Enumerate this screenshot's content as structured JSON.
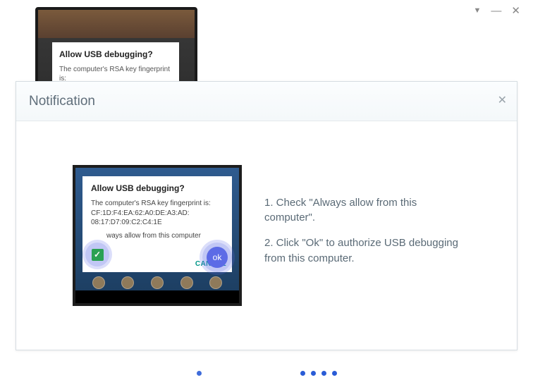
{
  "window": {
    "pin_glyph": "▼",
    "min_glyph": "—",
    "close_glyph": "✕"
  },
  "bg_phone": {
    "dialog_title": "Allow USB debugging?",
    "line1": "The computer's RSA key fingerprint",
    "line2": "is:"
  },
  "modal": {
    "title": "Notification",
    "close_glyph": "✕",
    "shot": {
      "title": "Allow USB debugging?",
      "fp_intro": "The computer's RSA key fingerprint is:",
      "fp_line1": "CF:1D:F4:EA:62:A0:DE:A3:AD:",
      "fp_line2": "08:17:D7:09:C2:C4:1E",
      "checkbox_label_partial": "ways allow from this computer",
      "check_glyph": "✓",
      "cancel_label": "CANCEL",
      "ok_label": "ok"
    },
    "instructions": {
      "step1": "1. Check \"Always allow from this computer\".",
      "step2": "2. Click \"Ok\" to authorize USB debugging from this computer."
    }
  }
}
